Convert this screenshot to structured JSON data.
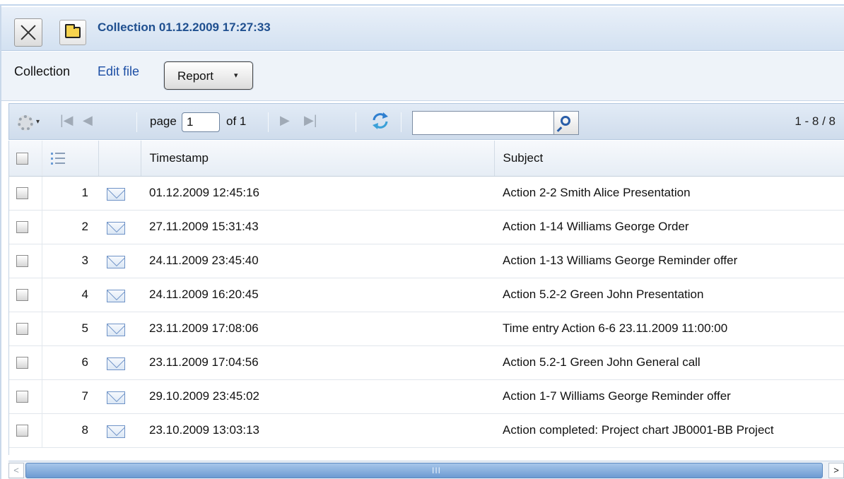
{
  "window": {
    "title": "Collection 01.12.2009 17:27:33",
    "close_icon": "close-icon",
    "folder_icon": "folder-icon"
  },
  "toolbar": {
    "collection_label": "Collection",
    "edit_link": "Edit file",
    "report_button": "Report",
    "report_arrow": "▾"
  },
  "pager": {
    "page_label": "page",
    "page_value": "1",
    "of_label": "of 1",
    "range_label": "1 - 8 / 8",
    "first_glyph": "|◀",
    "prev_glyph": "◀",
    "next_glyph": "▶",
    "last_glyph": "▶|",
    "search_value": ""
  },
  "table": {
    "columns": {
      "timestamp": "Timestamp",
      "subject": "Subject"
    },
    "rows": [
      {
        "n": "1",
        "timestamp": "01.12.2009 12:45:16",
        "subject": "Action 2-2 Smith Alice Presentation"
      },
      {
        "n": "2",
        "timestamp": "27.11.2009 15:31:43",
        "subject": "Action 1-14 Williams George Order"
      },
      {
        "n": "3",
        "timestamp": "24.11.2009 23:45:40",
        "subject": "Action 1-13 Williams George Reminder offer"
      },
      {
        "n": "4",
        "timestamp": "24.11.2009 16:20:45",
        "subject": "Action 5.2-2 Green John Presentation"
      },
      {
        "n": "5",
        "timestamp": "23.11.2009 17:08:06",
        "subject": "Time entry Action 6-6 23.11.2009 11:00:00"
      },
      {
        "n": "6",
        "timestamp": "23.11.2009 17:04:56",
        "subject": "Action 5.2-1 Green John General call"
      },
      {
        "n": "7",
        "timestamp": "29.10.2009 23:45:02",
        "subject": "Action 1-7 Williams George Reminder offer"
      },
      {
        "n": "8",
        "timestamp": "23.10.2009 13:03:13",
        "subject": "Action completed: Project chart JB0001-BB Project"
      }
    ]
  },
  "scrollbar": {
    "left_arrow": "<",
    "right_arrow": ">",
    "grip": "III"
  },
  "colors": {
    "title_text": "#1f4f8f",
    "link": "#1d4fa5",
    "scroll_thumb": "#6d9bd2"
  }
}
